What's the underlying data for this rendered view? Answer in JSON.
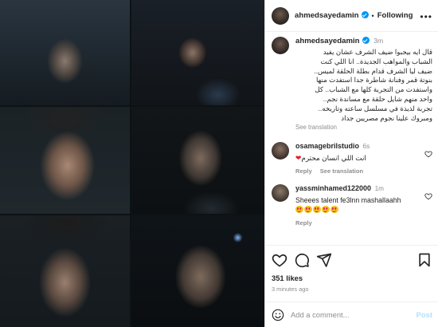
{
  "header": {
    "username": "ahmedsayedamin",
    "separator": "•",
    "follow_label": "Following",
    "more_label": "•••"
  },
  "caption": {
    "username": "ahmedsayedamin",
    "time": "3m",
    "lines": [
      "قال ايه بيجبوا ضيف الشرف عشان يفيد",
      "الشباب والمواهب الجديدة.. انا اللي كنت",
      "ضيف ليا الشرف قدام بطلة الحلقة لميس..",
      "بنوتة قمر وفنانة شاطرة جدا استفدت منها",
      "واستفدت من التجربة كلها مع الشباب.. كل",
      "واحد منهم شايل حلقة مع مساندة نجم..",
      "تجربة لذيذة في مسلسل ساعته وتاريخه..",
      "ومبروك علينا نجوم مصريين جداد"
    ],
    "see_translation": "See translation"
  },
  "comments": [
    {
      "username": "osamagebrilstudio",
      "time": "6s",
      "text": "انت اللي انسان محترم",
      "heart": "❤",
      "reply_label": "Reply",
      "translation_label": "See translation"
    },
    {
      "username": "yassminhamed122000",
      "time": "1m",
      "text": "Sheees talent fe3lnn mashallaahh",
      "reply_label": "Reply"
    }
  ],
  "actions": {
    "likes": "351 likes",
    "time_ago": "3 minutes ago"
  },
  "add_comment": {
    "placeholder": "Add a comment...",
    "post_label": "Post"
  },
  "colors": {
    "verified": "#0095f6",
    "muted": "#8e8e8e",
    "post_disabled": "#b2dffc"
  },
  "icons": [
    "verified-badge-icon",
    "more-options-icon",
    "like-heart-icon",
    "comment-icon",
    "share-icon",
    "save-bookmark-icon",
    "emoji-icon"
  ]
}
